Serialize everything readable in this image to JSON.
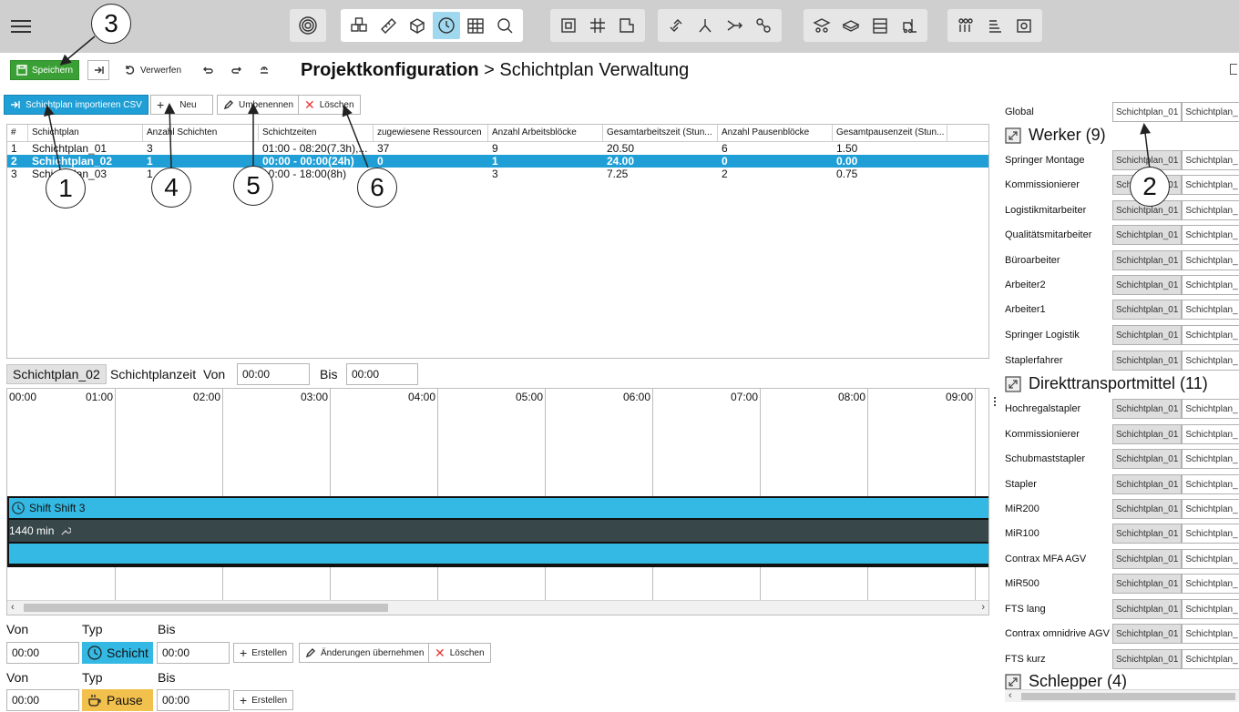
{
  "topbar": {
    "menu_icon": "hamburger-icon",
    "group1": [
      "target-icon"
    ],
    "group2": [
      "resource-cubes-icon",
      "ruler-icon",
      "boxes-icon",
      "clock-icon",
      "grid-calendar-icon",
      "search-process-icon"
    ],
    "group3": [
      "layout-frame-icon",
      "grid-icon",
      "area-icon"
    ],
    "group4": [
      "link-icon",
      "split-icon",
      "merge-icon",
      "chain-icon"
    ],
    "group5": [
      "transport-icon",
      "vehicle-icon",
      "rack-icon",
      "forklift-icon"
    ],
    "group6": [
      "people-icon",
      "stack-icon",
      "frame-icon"
    ]
  },
  "actions": {
    "save": "Speichern",
    "discard": "Verwerfen",
    "breadcrumb_root": "Projektkonfiguration",
    "breadcrumb_sep": ">",
    "breadcrumb_page": "Schichtplan Verwaltung"
  },
  "table_actions": {
    "import": "Schichtplan importieren CSV",
    "new": "Neu",
    "rename": "Umbenennen",
    "delete": "Löschen"
  },
  "table": {
    "columns": [
      "#",
      "Schichtplan",
      "Anzahl Schichten",
      "Schichtzeiten",
      "zugewiesene Ressourcen",
      "Anzahl Arbeitsblöcke",
      "Gesamtarbeitszeit (Stun...",
      "Anzahl Pausenblöcke",
      "Gesamtpausenzeit (Stun..."
    ],
    "rows": [
      [
        "1",
        "Schichtplan_01",
        "3",
        "01:00 - 08:20(7.3h),...",
        "37",
        "9",
        "20.50",
        "6",
        "1.50"
      ],
      [
        "2",
        "Schichtplan_02",
        "1",
        "00:00 - 00:00(24h)",
        "0",
        "1",
        "24.00",
        "0",
        "0.00"
      ],
      [
        "3",
        "Schichtplan_03",
        "1",
        "10:00 - 18:00(8h)",
        "",
        "3",
        "7.25",
        "2",
        "0.75"
      ]
    ],
    "selected_index": 1
  },
  "planner": {
    "plan_name": "Schichtplan_02",
    "label_time": "Schichtplanzeit",
    "label_from": "Von",
    "from_value": "00:00",
    "label_to": "Bis",
    "to_value": "00:00",
    "ticks": [
      "00:00",
      "01:00",
      "02:00",
      "03:00",
      "04:00",
      "05:00",
      "06:00",
      "07:00",
      "08:00",
      "09:00"
    ],
    "shift_label": "Shift Shift 3",
    "duration": "1440 min",
    "shift_color": "#33b9e3",
    "bar_color": "#37474a"
  },
  "form": {
    "col_from": "Von",
    "col_type": "Typ",
    "col_to": "Bis",
    "row1": {
      "from": "00:00",
      "type": "Schicht",
      "to": "00:00",
      "create": "Erstellen",
      "apply": "Änderungen übernehmen",
      "delete": "Löschen",
      "color": "#33b9e3"
    },
    "row2": {
      "from": "00:00",
      "type": "Pause",
      "to": "00:00",
      "create": "Erstellen",
      "color": "#f2c04d"
    }
  },
  "right_panel": {
    "global": "Global",
    "chip_a": "Schichtplan_01",
    "chip_b": "Schichtplan_",
    "sections": [
      {
        "title": "Werker (9)",
        "items": [
          "Springer Montage",
          "Kommissionierer",
          "Logistikmitarbeiter",
          "Qualitätsmitarbeiter",
          "Büroarbeiter",
          "Arbeiter2",
          "Arbeiter1",
          "Springer Logistik",
          "Staplerfahrer"
        ]
      },
      {
        "title": "Direkttransportmittel (11)",
        "items": [
          "Hochregalstapler",
          "Kommissionierer",
          "Schubmaststapler",
          "Stapler",
          "MiR200",
          "MiR100",
          "Contrax MFA AGV",
          "MiR500",
          "FTS lang",
          "Contrax omnidrive AGV",
          "FTS kurz"
        ]
      },
      {
        "title": "Schlepper (4)",
        "items": []
      }
    ]
  },
  "callouts": [
    "1",
    "2",
    "3",
    "4",
    "5",
    "6"
  ]
}
